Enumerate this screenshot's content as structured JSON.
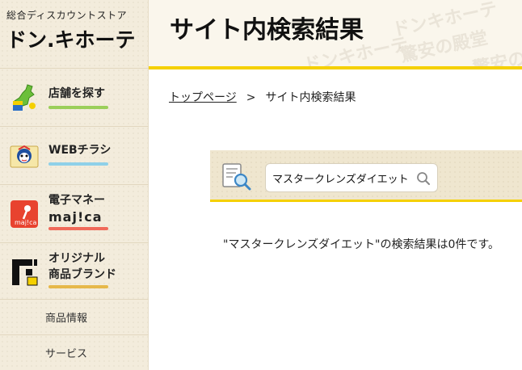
{
  "brand": {
    "tagline": "総合ディスカウントストア",
    "name": "ドン.キホーテ"
  },
  "sidebar": {
    "items": [
      {
        "label": "店舗を探す",
        "icon": "japan-map-icon",
        "underline_color": "#9bcf5a"
      },
      {
        "label": "WEBチラシ",
        "icon": "mascot-flyer-icon",
        "underline_color": "#8fd0e8"
      },
      {
        "label": "電子マネー",
        "sublabel": "maj!ca",
        "icon": "majica-card-icon",
        "underline_color": "#f06a5a"
      },
      {
        "label": "オリジナル",
        "sublabel": "商品ブランド",
        "icon": "private-brand-icon",
        "underline_color": "#e6b84a"
      }
    ],
    "sub_items": [
      {
        "label": "商品情報"
      },
      {
        "label": "サービス"
      }
    ]
  },
  "header": {
    "title": "サイト内検索結果",
    "watermarks": [
      "ドンキホーテ",
      "驚安の殿堂",
      "ドンキホーテ",
      "驚安の殿堂"
    ]
  },
  "breadcrumb": {
    "home": "トップページ",
    "separator": ">",
    "current": "サイト内検索結果"
  },
  "search": {
    "value": "マスタークレンズダイエット",
    "icon": "search-icon"
  },
  "result": {
    "message": "\"マスタークレンズダイエット\"の検索結果は0件です。"
  },
  "colors": {
    "accent_yellow": "#f5d000",
    "sidebar_bg": "#f3ecdc"
  }
}
